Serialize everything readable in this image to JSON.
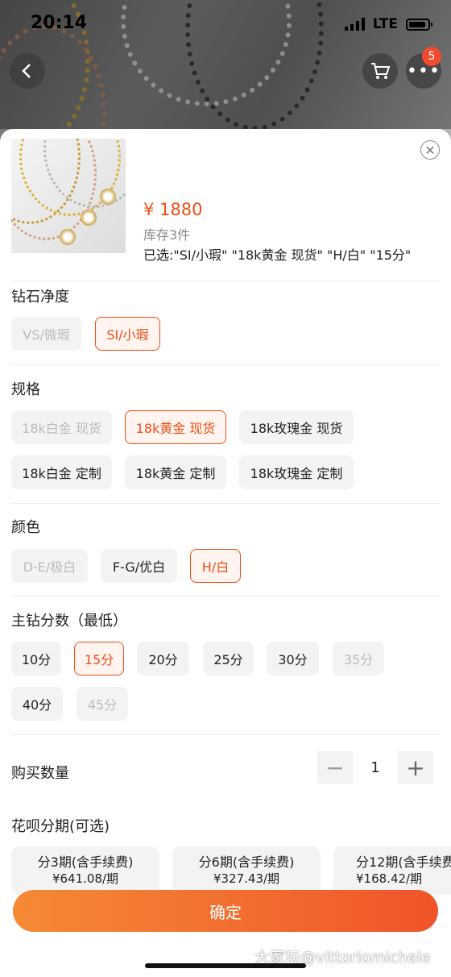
{
  "status_bar": {
    "time": "20:14",
    "network": "LTE"
  },
  "header": {
    "cart_badge": "5"
  },
  "product": {
    "price": "¥ 1880",
    "stock": "库存3件",
    "selected": "已选:\"SI/小瑕\" \"18k黄金 现货\" \"H/白\" \"15分\""
  },
  "clarity": {
    "title": "钻石净度",
    "options": [
      {
        "label": "VS/微瑕",
        "state": "disabled"
      },
      {
        "label": "SI/小瑕",
        "state": "selected"
      }
    ]
  },
  "spec": {
    "title": "规格",
    "options": [
      {
        "label": "18k白金 现货",
        "state": "disabled"
      },
      {
        "label": "18k黄金 现货",
        "state": "selected"
      },
      {
        "label": "18k玫瑰金 现货",
        "state": "normal"
      },
      {
        "label": "18k白金 定制",
        "state": "normal"
      },
      {
        "label": "18k黄金 定制",
        "state": "normal"
      },
      {
        "label": "18k玫瑰金 定制",
        "state": "normal"
      }
    ]
  },
  "color": {
    "title": "颜色",
    "options": [
      {
        "label": "D-E/极白",
        "state": "disabled"
      },
      {
        "label": "F-G/优白",
        "state": "normal"
      },
      {
        "label": "H/白",
        "state": "selected"
      }
    ]
  },
  "carat": {
    "title": "主钻分数（最低）",
    "options": [
      {
        "label": "10分",
        "state": "normal"
      },
      {
        "label": "15分",
        "state": "selected"
      },
      {
        "label": "20分",
        "state": "normal"
      },
      {
        "label": "25分",
        "state": "normal"
      },
      {
        "label": "30分",
        "state": "normal"
      },
      {
        "label": "35分",
        "state": "disabled"
      },
      {
        "label": "40分",
        "state": "normal"
      },
      {
        "label": "45分",
        "state": "disabled"
      }
    ]
  },
  "quantity": {
    "title": "购买数量",
    "minus": "−",
    "value": "1",
    "plus": "+"
  },
  "installment": {
    "title": "花呗分期(可选)",
    "plans": [
      {
        "label": "分3期(含手续费)",
        "amount": "¥641.08/期"
      },
      {
        "label": "分6期(含手续费)",
        "amount": "¥327.43/期"
      },
      {
        "label": "分12期(含手续费)",
        "amount": "¥168.42/期"
      }
    ]
  },
  "confirm_label": "确定",
  "watermark": "大家坛@vittoriomichele",
  "colors": {
    "accent": "#f04e16",
    "button_start": "#f58a35",
    "button_end": "#f0542a"
  }
}
